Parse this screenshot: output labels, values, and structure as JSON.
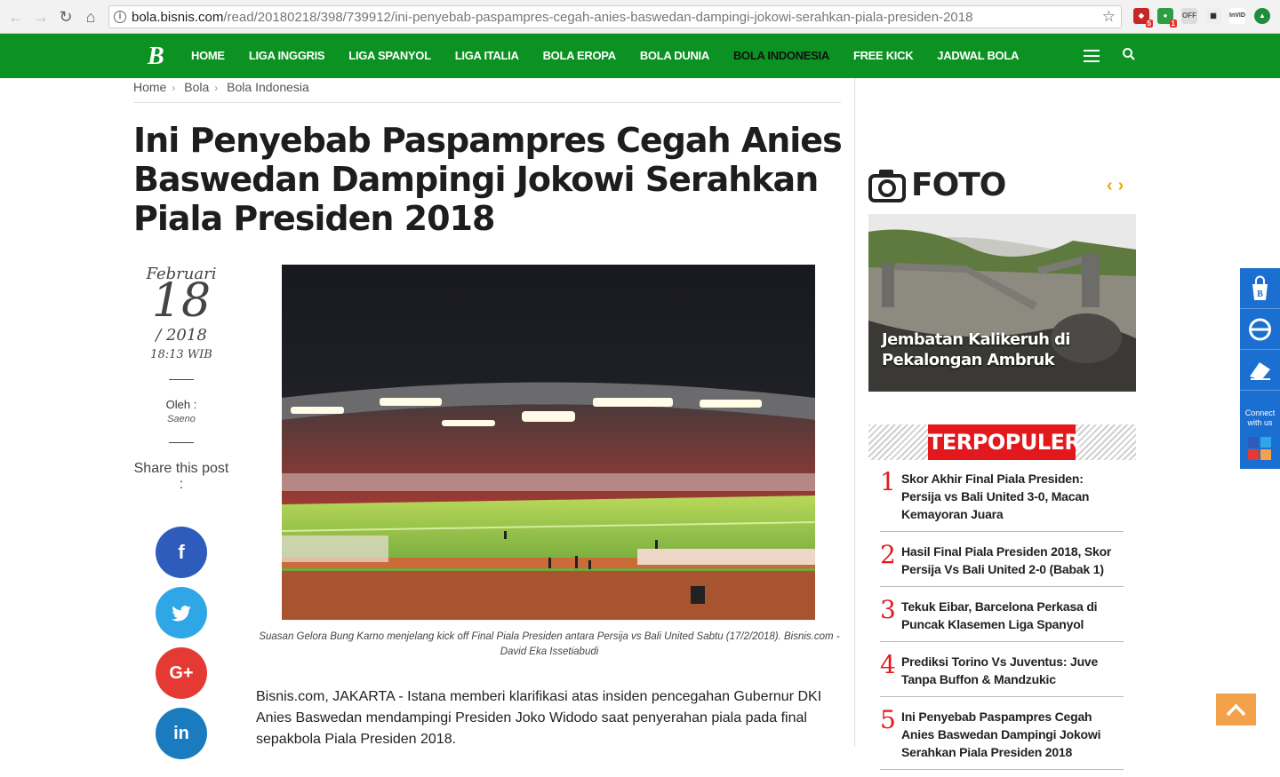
{
  "browser": {
    "url_host": "bola.bisnis.com",
    "url_path": "/read/20180218/398/739912/ini-penyebab-paspampres-cegah-anies-baswedan-dampingi-jokowi-serahkan-piala-presiden-2018",
    "ext_badges": [
      "5",
      "1"
    ],
    "ext_labels": [
      "OFF",
      "InVID"
    ]
  },
  "site": {
    "logo": "B",
    "accent_color": "#0c9123",
    "menu": [
      "HOME",
      "LIGA INGGRIS",
      "LIGA SPANYOL",
      "LIGA ITALIA",
      "BOLA EROPA",
      "BOLA DUNIA",
      "BOLA INDONESIA",
      "FREE KICK",
      "JADWAL BOLA"
    ],
    "active_menu": "BOLA INDONESIA"
  },
  "breadcrumb": [
    "Home",
    "Bola",
    "Bola Indonesia"
  ],
  "article": {
    "title": "Ini Penyebab Paspampres Cegah Anies Baswedan Dampingi Jokowi Serahkan Piala Presiden 2018",
    "date_month": "Februari",
    "date_day": "18",
    "date_year": "/ 2018",
    "time": "18:13 WIB",
    "by_label": "Oleh :",
    "author": "Saeno",
    "share_label": "Share this post :",
    "caption": "Suasan Gelora Bung Karno menjelang kick off Final Piala Presiden antara Persija vs Bali United Sabtu (17/2/2018). Bisnis.com - David Eka Issetiabudi",
    "body": "Bisnis.com, JAKARTA - Istana memberi klarifikasi atas insiden pencegahan Gubernur DKI Anies Baswedan mendampingi Presiden Joko Widodo saat penyerahan piala pada final sepakbola Piala Presiden 2018."
  },
  "social": [
    {
      "name": "facebook",
      "glyph": "f",
      "color": "#2d5cbd"
    },
    {
      "name": "twitter",
      "glyph": "🐦",
      "color": "#2fa6e6"
    },
    {
      "name": "google-plus",
      "glyph": "G+",
      "color": "#e53a33"
    },
    {
      "name": "linkedin",
      "glyph": "in",
      "color": "#1a7bbf"
    }
  ],
  "sidebar": {
    "foto_label": "FOTO",
    "foto_caption": "Jembatan Kalikeruh di Pekalongan Ambruk",
    "popular_label": "TERPOPULER",
    "popular": [
      {
        "num": "1",
        "title": "Skor Akhir Final Piala Presiden: Persija vs Bali United 3-0, Macan Kemayoran Juara"
      },
      {
        "num": "2",
        "title": "Hasil Final Piala Presiden 2018, Skor Persija Vs Bali United 2-0 (Babak 1)"
      },
      {
        "num": "3",
        "title": "Tekuk Eibar, Barcelona Perkasa di Puncak Klasemen Liga Spanyol"
      },
      {
        "num": "4",
        "title": "Prediksi Torino Vs Juventus: Juve Tanpa Buffon & Mandzukic"
      },
      {
        "num": "5",
        "title": "Ini Penyebab Paspampres Cegah Anies Baswedan Dampingi Jokowi Serahkan Piala Presiden 2018"
      }
    ]
  },
  "float_bar": {
    "connect": "Connect with us"
  }
}
